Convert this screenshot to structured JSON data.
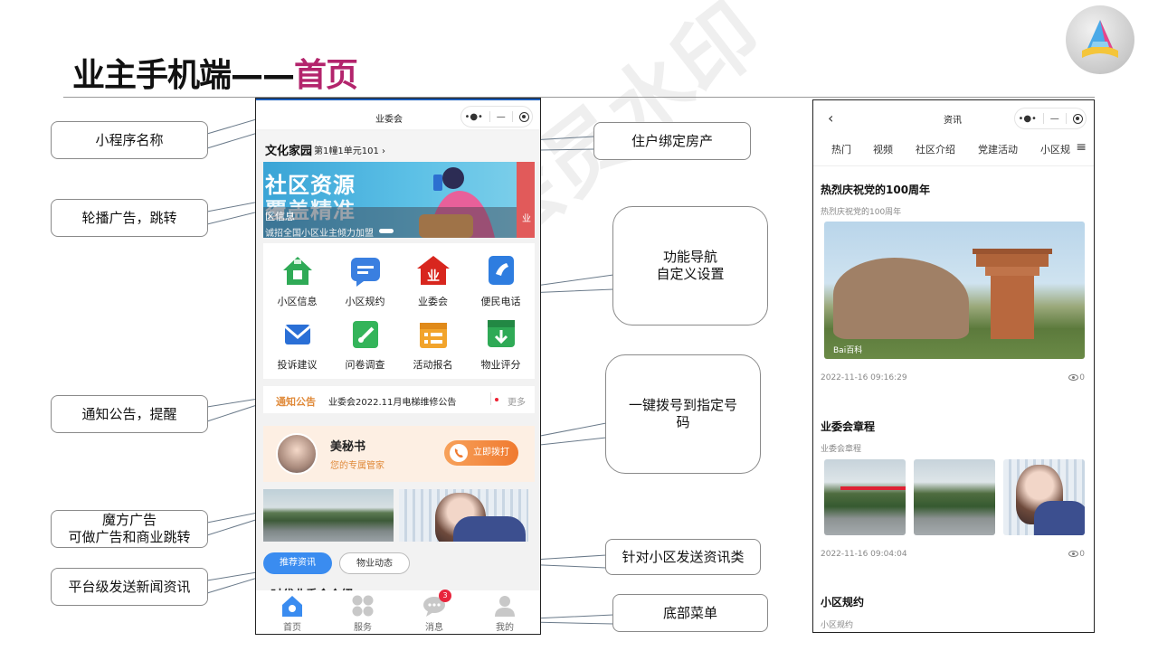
{
  "slide": {
    "title_main": "业主手机端——",
    "title_accent": "首页",
    "watermark": "非会员水印"
  },
  "callouts": {
    "mini_program_name": "小程序名称",
    "carousel": "轮播广告，跳转",
    "notice": "通知公告，提醒",
    "cube_ad": "魔方广告\n可做广告和商业跳转",
    "platform_news": "平台级发送新闻资讯",
    "bind_house": "住户绑定房产",
    "func_nav": "功能导航\n自定义设置",
    "one_click_call": "一键拨号到指定号\n码",
    "community_news": "针对小区发送资讯类",
    "bottom_menu": "底部菜单"
  },
  "phone": {
    "title": "业委会",
    "capsule_dots": "•●•",
    "capsule_minus": "—",
    "house_name": "文化家园",
    "house_unit": "第1幢1单元101 ›",
    "banner": {
      "line1": "社区资源",
      "line2": "覆盖精准",
      "caption": "区信息",
      "subcaption": "诚招全国小区业主倾力加盟",
      "right_label": "业"
    },
    "functions": [
      {
        "label": "小区信息"
      },
      {
        "label": "小区规约"
      },
      {
        "label": "业委会"
      },
      {
        "label": "便民电话"
      },
      {
        "label": "投诉建议"
      },
      {
        "label": "问卷调查"
      },
      {
        "label": "活动报名"
      },
      {
        "label": "物业评分"
      }
    ],
    "notice": {
      "tag": "通知公告",
      "text": "业委会2022.11月电梯维修公告",
      "more": "更多"
    },
    "secretary": {
      "name": "美秘书",
      "role": "您的专属管家",
      "call": "立即拨打"
    },
    "tabs": {
      "active": "推荐资讯",
      "idle": "物业动态"
    },
    "cut_title": "时代业委会介绍",
    "tabbar": [
      {
        "label": "首页"
      },
      {
        "label": "服务"
      },
      {
        "label": "消息",
        "badge": "3"
      },
      {
        "label": "我的"
      }
    ]
  },
  "phone2": {
    "back": "‹",
    "title": "资讯",
    "tabs": [
      "热门",
      "视频",
      "社区介绍",
      "党建活动",
      "小区规"
    ],
    "menu": "≡",
    "articles": [
      {
        "title": "热烈庆祝党的100周年",
        "sub": "热烈庆祝党的100周年",
        "date": "2022-11-16 09:16:29",
        "views": "0",
        "photo_mark": "Bai百科"
      },
      {
        "title": "业委会章程",
        "sub": "业委会章程",
        "date": "2022-11-16 09:04:04",
        "views": "0"
      },
      {
        "title": "小区规约",
        "sub": "小区规约"
      }
    ]
  },
  "colors": {
    "accent": "#b3246c",
    "tab_active": "#3a8cf0",
    "call_button": "#f07a30",
    "notice_tag": "#e08a3a",
    "badge": "#e8243c"
  }
}
